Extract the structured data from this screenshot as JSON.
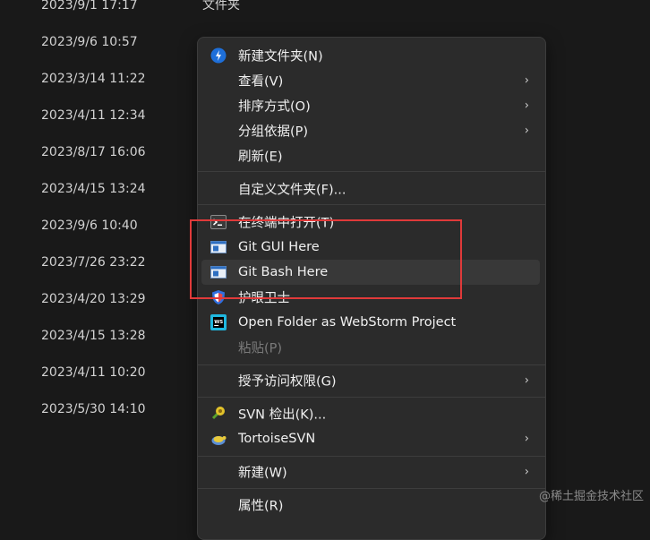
{
  "files": [
    {
      "date": "2023/9/1 17:17",
      "type": "文件夹"
    },
    {
      "date": "2023/9/6 10:57",
      "type": ""
    },
    {
      "date": "2023/3/14 11:22",
      "type": ""
    },
    {
      "date": "2023/4/11 12:34",
      "type": ""
    },
    {
      "date": "2023/8/17 16:06",
      "type": ""
    },
    {
      "date": "2023/4/15 13:24",
      "type": ""
    },
    {
      "date": "2023/9/6 10:40",
      "type": ""
    },
    {
      "date": "2023/7/26 23:22",
      "type": ""
    },
    {
      "date": "2023/4/20 13:29",
      "type": ""
    },
    {
      "date": "2023/4/15 13:28",
      "type": ""
    },
    {
      "date": "2023/4/11 10:20",
      "type": ""
    },
    {
      "date": "2023/5/30 14:10",
      "type": ""
    }
  ],
  "menu": {
    "new_folder": "新建文件夹(N)",
    "view": "查看(V)",
    "sort_by": "排序方式(O)",
    "group_by": "分组依据(P)",
    "refresh": "刷新(E)",
    "customize_folder": "自定义文件夹(F)...",
    "open_in_terminal": "在终端中打开(T)",
    "git_gui": "Git GUI Here",
    "git_bash": "Git Bash Here",
    "eye_guard": "护眼卫士",
    "webstorm": "Open Folder as WebStorm Project",
    "paste": "粘贴(P)",
    "grant_access": "授予访问权限(G)",
    "svn_checkout": "SVN 检出(K)...",
    "tortoise_svn": "TortoiseSVN",
    "new": "新建(W)",
    "properties": "属性(R)"
  },
  "icons": {
    "new_folder": "new-folder-icon",
    "terminal": "terminal-icon",
    "git": "git-icon",
    "shield": "shield-icon",
    "webstorm": "webstorm-icon",
    "svn": "svn-icon",
    "tortoise": "tortoise-icon",
    "submenu": "chevron-right-icon"
  },
  "colors": {
    "highlight_box": "#e03a3a",
    "menu_bg": "#2b2b2b",
    "page_bg": "#191919"
  },
  "watermark": "@稀土掘金技术社区"
}
